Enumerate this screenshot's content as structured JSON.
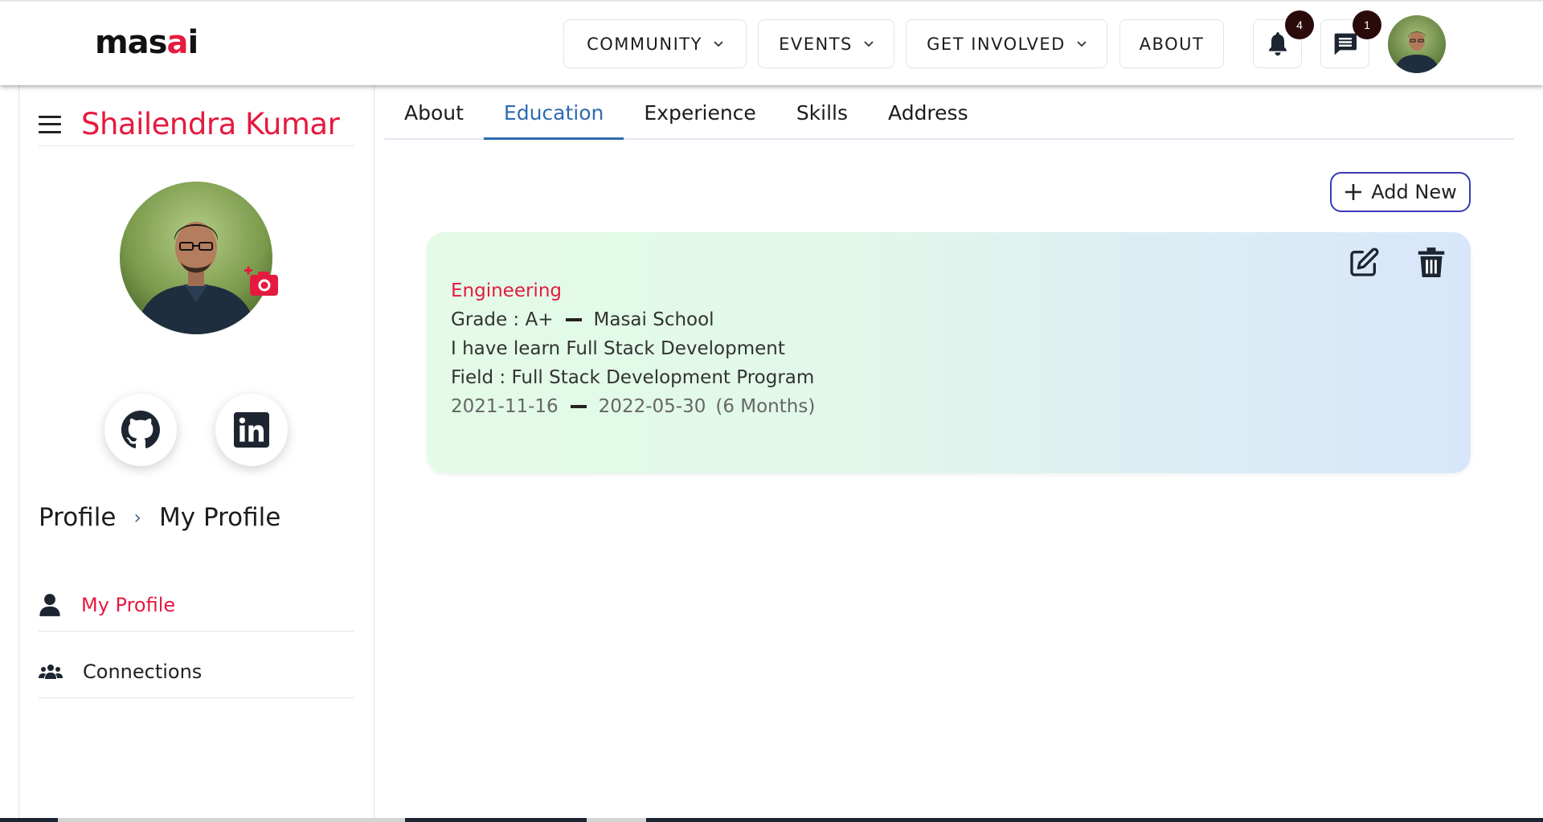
{
  "brand": {
    "logo_text": "masai",
    "accent_color": "#e51a3f"
  },
  "nav": {
    "community": "COMMUNITY",
    "events": "EVENTS",
    "get_involved": "GET INVOLVED",
    "about": "ABOUT",
    "notifications_count": "4",
    "messages_count": "1",
    "icons": {
      "notifications": "bell-icon",
      "messages": "chat-icon"
    }
  },
  "sidebar": {
    "user_name": "Shailendra Kumar",
    "social": [
      "github-icon",
      "linkedin-icon"
    ],
    "breadcrumb": {
      "parent": "Profile",
      "current": "My Profile"
    },
    "items": [
      {
        "label": "My Profile",
        "icon": "person-icon",
        "active": true
      },
      {
        "label": "Connections",
        "icon": "people-icon",
        "active": false
      }
    ]
  },
  "tabs": [
    {
      "label": "About",
      "active": false
    },
    {
      "label": "Education",
      "active": true
    },
    {
      "label": "Experience",
      "active": false
    },
    {
      "label": "Skills",
      "active": false
    },
    {
      "label": "Address",
      "active": false
    }
  ],
  "main": {
    "add_new_label": "Add New",
    "education": {
      "degree": "Engineering",
      "grade": "Grade : A+",
      "school": "Masai School",
      "description": "I have learn Full Stack Development",
      "field": "Field : Full Stack Development Program",
      "start_date": "2021-11-16",
      "end_date": "2022-05-30",
      "duration": "(6 Months)"
    }
  }
}
